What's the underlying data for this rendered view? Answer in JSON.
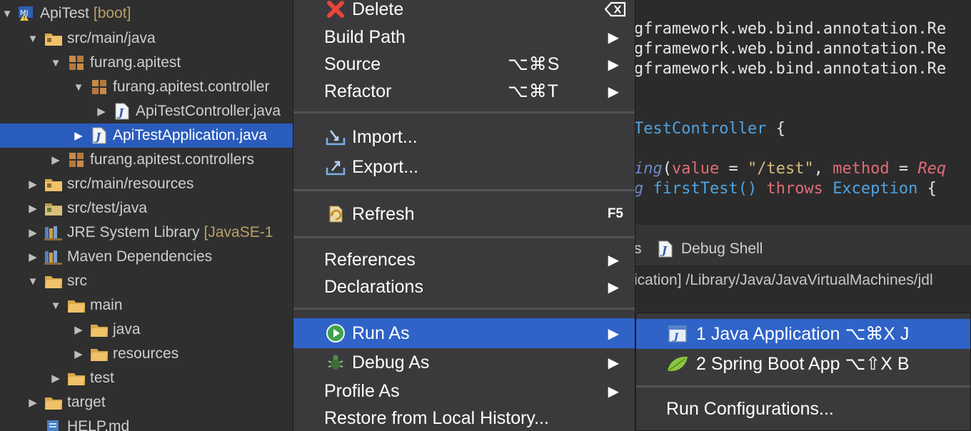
{
  "explorer": {
    "rows": [
      {
        "label": "ApiTest",
        "deco": "[boot]"
      },
      {
        "label": "src/main/java"
      },
      {
        "label": "furang.apitest"
      },
      {
        "label": "furang.apitest.controller"
      },
      {
        "label": "ApiTestController.java"
      },
      {
        "label": "ApiTestApplication.java"
      },
      {
        "label": "furang.apitest.controllers"
      },
      {
        "label": "src/main/resources"
      },
      {
        "label": "src/test/java"
      },
      {
        "label": "JRE System Library",
        "deco": "[JavaSE-1"
      },
      {
        "label": "Maven Dependencies"
      },
      {
        "label": "src"
      },
      {
        "label": "main"
      },
      {
        "label": "java"
      },
      {
        "label": "resources"
      },
      {
        "label": "test"
      },
      {
        "label": "target"
      },
      {
        "label": "HELP.md"
      }
    ]
  },
  "editor": {
    "imports": [
      "gframework.web.bind.annotation.Re",
      "gframework.web.bind.annotation.Re",
      "gframework.web.bind.annotation.Re"
    ],
    "class_name": "TestController",
    "class_brace": "{",
    "mapping_prefix": "ing",
    "mapping_args": {
      "value_kw": "value",
      "eq": " = ",
      "value_str": "\"/test\"",
      "comma": ", ",
      "method_kw": "method",
      "method_val": "Req"
    },
    "method_line": {
      "prefix": "g ",
      "name": "firstTest()",
      "throws": "throws",
      "exception": "Exception",
      "brace": "{"
    }
  },
  "console": {
    "tab_partial": "s",
    "tab_debug_shell": "Debug Shell",
    "path": "ication] /Library/Java/JavaVirtualMachines/jdl"
  },
  "context_menu": {
    "delete": "Delete",
    "build_path": "Build Path",
    "source": "Source",
    "source_shortcut": "⌥⌘S",
    "refactor": "Refactor",
    "refactor_shortcut": "⌥⌘T",
    "import": "Import...",
    "export": "Export...",
    "refresh": "Refresh",
    "refresh_key": "F5",
    "references": "References",
    "declarations": "Declarations",
    "run_as": "Run As",
    "debug_as": "Debug As",
    "profile_as": "Profile As",
    "restore": "Restore from Local History...",
    "arrow": "▶"
  },
  "submenu": {
    "java_app": "1 Java Application ⌥⌘X J",
    "spring_boot": "2 Spring Boot App ⌥⇧X B",
    "run_configs": "Run Configurations..."
  },
  "colors": {
    "selection": "#2a5cbd",
    "menu_highlight": "#2f63c8",
    "menu_bg": "#3a3a3c"
  }
}
